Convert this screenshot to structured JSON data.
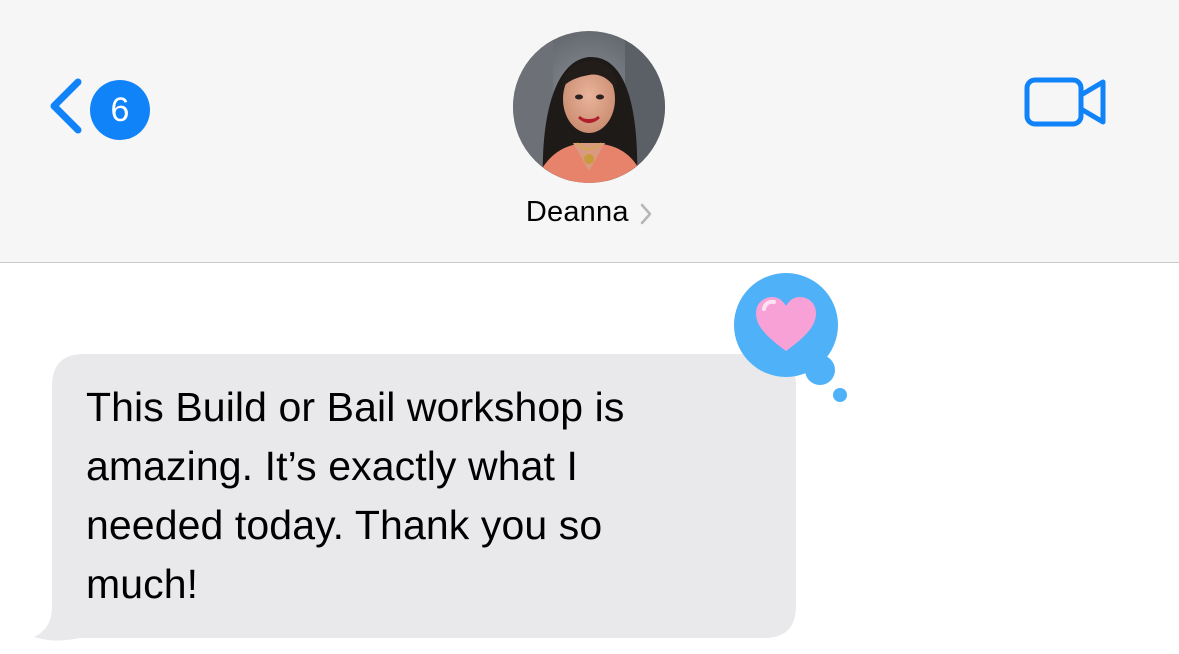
{
  "header": {
    "back_badge_count": "6",
    "contact_name": "Deanna"
  },
  "messages": [
    {
      "direction": "incoming",
      "text": "This Build or Bail workshop is\namazing. It’s exactly what I\nneeded today. Thank you so\nmuch!",
      "reaction": "heart"
    }
  ],
  "colors": {
    "accent": "#1183f9",
    "header_background": "#f6f6f6",
    "incoming_bubble": "#e9e9eb",
    "tapback_background": "#4fb1f7",
    "heart": "#f7a1d6"
  },
  "icons": {
    "back": "chevron-left-icon",
    "video": "video-camera-icon",
    "contact_detail": "chevron-right-icon",
    "reaction": "heart-icon"
  }
}
